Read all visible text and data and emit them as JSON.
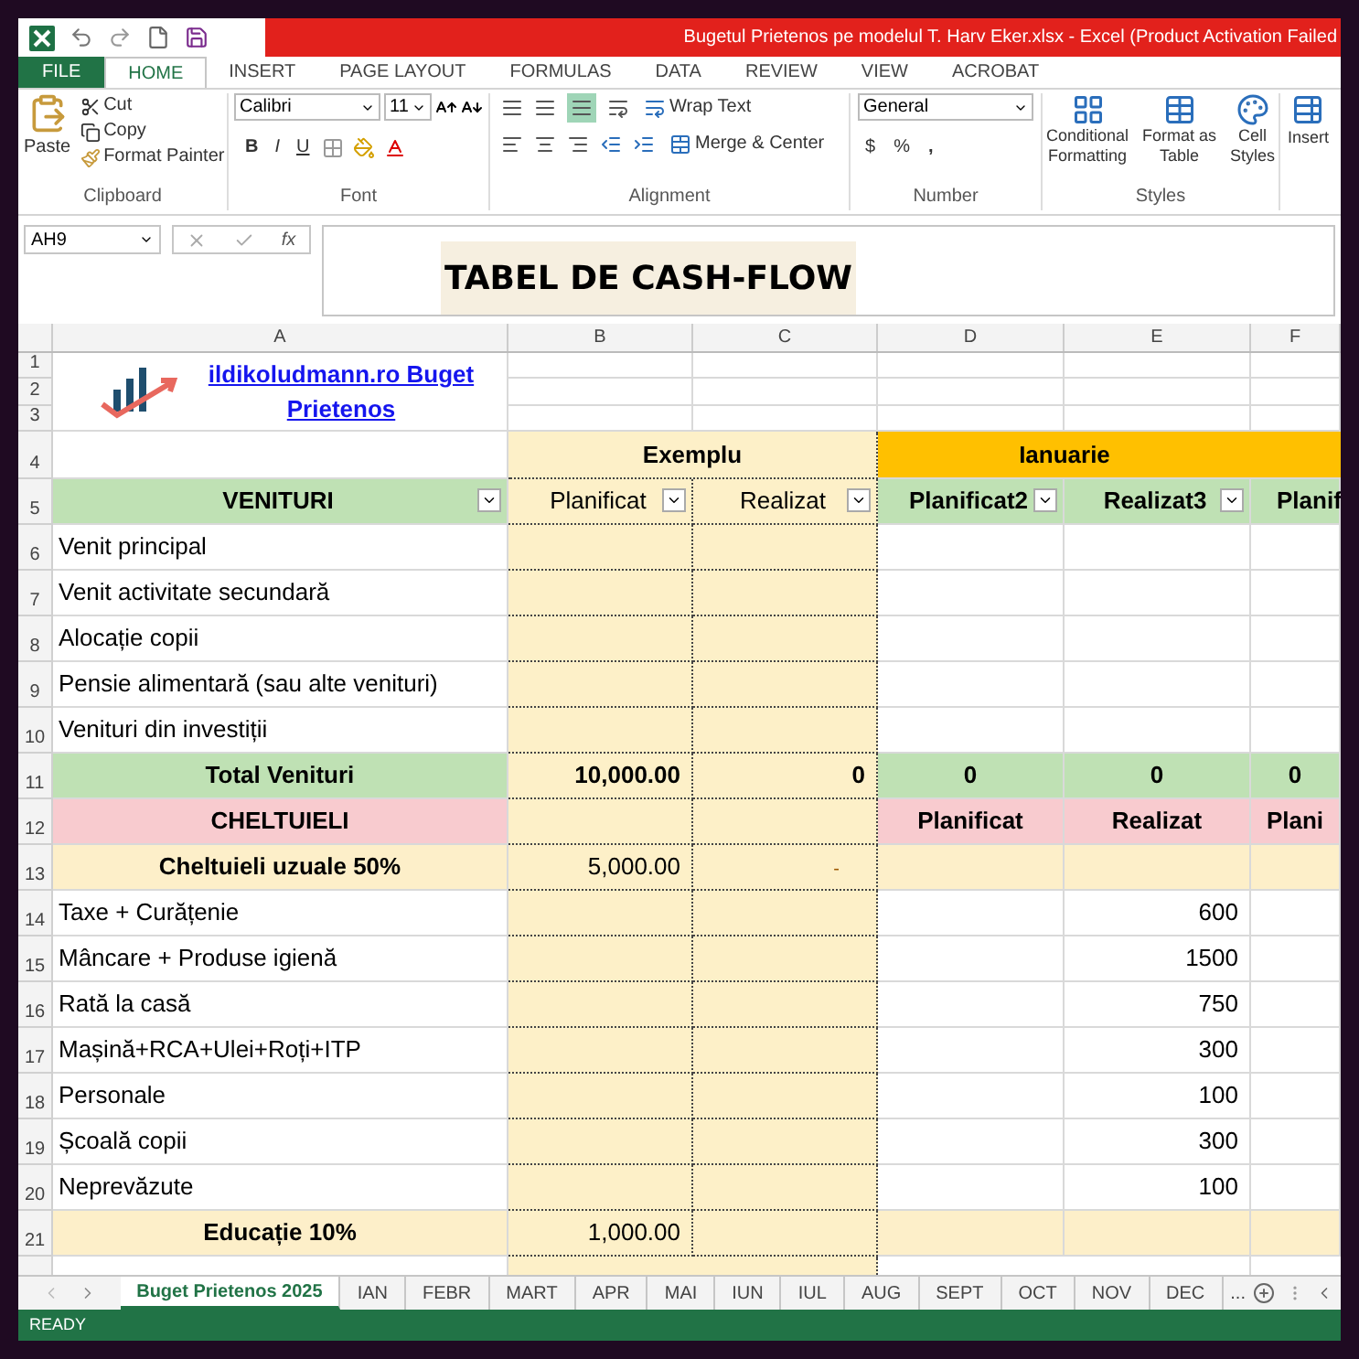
{
  "window": {
    "title": "Bugetul Prietenos pe modelul T. Harv Eker.xlsx -  Excel (Product Activation Failed"
  },
  "ribbon_tabs": [
    {
      "label": "FILE",
      "kind": "file",
      "selected": false
    },
    {
      "label": "HOME",
      "kind": "tab",
      "selected": true
    },
    {
      "label": "INSERT",
      "kind": "tab",
      "selected": false
    },
    {
      "label": "PAGE LAYOUT",
      "kind": "tab",
      "selected": false
    },
    {
      "label": "FORMULAS",
      "kind": "tab",
      "selected": false
    },
    {
      "label": "DATA",
      "kind": "tab",
      "selected": false
    },
    {
      "label": "REVIEW",
      "kind": "tab",
      "selected": false
    },
    {
      "label": "VIEW",
      "kind": "tab",
      "selected": false
    },
    {
      "label": "ACROBAT",
      "kind": "tab",
      "selected": false
    }
  ],
  "ribbon": {
    "clipboard": {
      "paste": "Paste",
      "cut": "Cut",
      "copy": "Copy",
      "format_painter": "Format Painter",
      "group": "Clipboard"
    },
    "font": {
      "name": "Calibri",
      "size": "11",
      "bold": "B",
      "italic": "I",
      "underline": "U",
      "group": "Font"
    },
    "alignment": {
      "wrap": "Wrap Text",
      "merge": "Merge & Center",
      "group": "Alignment"
    },
    "number": {
      "format": "General",
      "currency": "$",
      "percent": "%",
      "comma": ",",
      "group": "Number"
    },
    "styles": {
      "conditional": [
        "Conditional",
        "Formatting"
      ],
      "format_table": [
        "Format as",
        "Table"
      ],
      "cell_styles": [
        "Cell",
        "Styles"
      ],
      "group": "Styles"
    },
    "cells": {
      "insert": "Insert"
    }
  },
  "formula_bar": {
    "name_box": "AH9",
    "fx": "fx"
  },
  "title_box": "TABEL DE CASH-FLOW",
  "sheet": {
    "columns": [
      "A",
      "B",
      "C",
      "D",
      "E",
      "F"
    ],
    "logo_rows": [
      "1",
      "2",
      "3"
    ],
    "logo_link": "ildikoludmann.ro   Buget Prietenos",
    "rows": [
      {
        "number": "4",
        "kind": "group",
        "b": "Exemplu",
        "d_e": "Ianuarie"
      },
      {
        "number": "5",
        "kind": "header",
        "a": "VENITURI",
        "b": "Planificat",
        "c": "Realizat",
        "d": "Planificat2",
        "e": "Realizat3",
        "f": "Planif"
      },
      {
        "number": "6",
        "kind": "item",
        "a": "Venit principal"
      },
      {
        "number": "7",
        "kind": "item",
        "a": "Venit activitate secundară"
      },
      {
        "number": "8",
        "kind": "item",
        "a": "Alocație copii"
      },
      {
        "number": "9",
        "kind": "item",
        "a": "Pensie alimentară (sau alte venituri)"
      },
      {
        "number": "10",
        "kind": "item",
        "a": "Venituri din investiții"
      },
      {
        "number": "11",
        "kind": "total",
        "a": "Total Venituri",
        "b": "10,000.00",
        "c": "0",
        "d": "0",
        "e": "0",
        "f": "0"
      },
      {
        "number": "12",
        "kind": "section",
        "a": "CHELTUIELI",
        "d": "Planificat",
        "e": "Realizat",
        "f": "Plani"
      },
      {
        "number": "13",
        "kind": "subtotal",
        "a": "Cheltuieli uzuale 50%",
        "b": "5,000.00",
        "c": "-"
      },
      {
        "number": "14",
        "kind": "item",
        "a": "Taxe + Curățenie",
        "e": "600"
      },
      {
        "number": "15",
        "kind": "item",
        "a": "Mâncare + Produse igienă",
        "e": "1500"
      },
      {
        "number": "16",
        "kind": "item",
        "a": "Rată la casă",
        "e": "750"
      },
      {
        "number": "17",
        "kind": "item",
        "a": "Mașină+RCA+Ulei+Roți+ITP",
        "e": "300"
      },
      {
        "number": "18",
        "kind": "item",
        "a": "Personale",
        "e": "100"
      },
      {
        "number": "19",
        "kind": "item",
        "a": "Școală copii",
        "e": "300"
      },
      {
        "number": "20",
        "kind": "item",
        "a": "Neprevăzute",
        "e": "100"
      },
      {
        "number": "21",
        "kind": "subtotal",
        "a": "Educație 10%",
        "b": "1,000.00"
      }
    ]
  },
  "sheet_tabs": [
    {
      "label": "Buget Prietenos 2025",
      "selected": true
    },
    {
      "label": "IAN",
      "selected": false
    },
    {
      "label": "FEBR",
      "selected": false
    },
    {
      "label": "MART",
      "selected": false
    },
    {
      "label": "APR",
      "selected": false
    },
    {
      "label": "MAI",
      "selected": false
    },
    {
      "label": "IUN",
      "selected": false
    },
    {
      "label": "IUL",
      "selected": false
    },
    {
      "label": "AUG",
      "selected": false
    },
    {
      "label": "SEPT",
      "selected": false
    },
    {
      "label": "OCT",
      "selected": false
    },
    {
      "label": "NOV",
      "selected": false
    },
    {
      "label": "DEC",
      "selected": false
    }
  ],
  "more_sheets": "...",
  "status_bar": {
    "text": "READY"
  }
}
